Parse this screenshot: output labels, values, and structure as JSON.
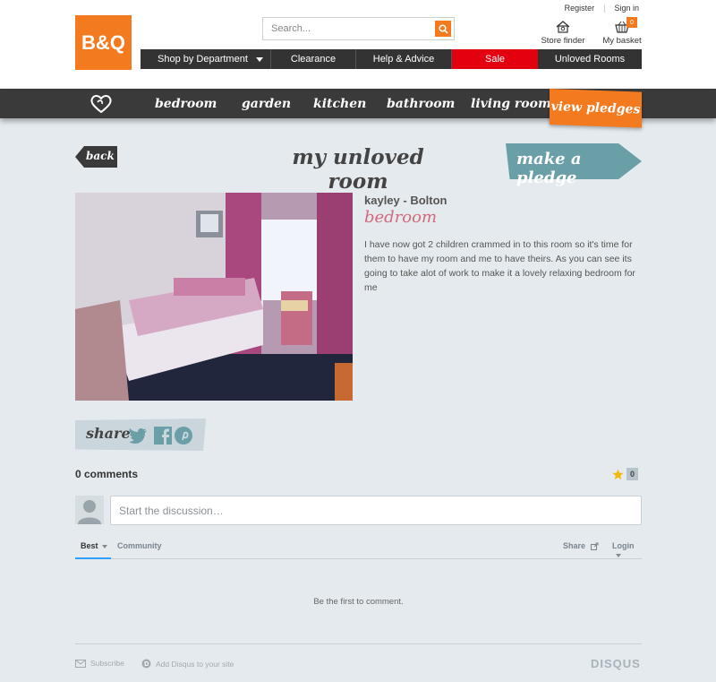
{
  "header": {
    "logo": "B&Q",
    "search": {
      "placeholder": "Search..."
    },
    "register": "Register",
    "signin": "Sign in",
    "store_finder": "Store finder",
    "basket": {
      "label": "My basket",
      "count": "0"
    }
  },
  "main_nav": {
    "items": [
      {
        "label": "Shop by Department"
      },
      {
        "label": "Clearance"
      },
      {
        "label": "Help & Advice"
      },
      {
        "label": "Sale"
      },
      {
        "label": "Unloved Rooms"
      }
    ]
  },
  "categories": {
    "items": [
      {
        "label": "bedroom"
      },
      {
        "label": "garden"
      },
      {
        "label": "kitchen"
      },
      {
        "label": "bathroom"
      },
      {
        "label": "living room"
      }
    ],
    "active": "view pledges"
  },
  "page": {
    "back": "back",
    "title": "my unloved room",
    "make_pledge": "make a pledge"
  },
  "room": {
    "author": "kayley - Bolton",
    "type": "bedroom",
    "description": "I have now got 2 children crammed in to this room so it's time for them to have my room and me to have theirs. As you can see its going to take alot of work to make it a lovely relaxing bedroom for me"
  },
  "share": {
    "label": "share"
  },
  "comments": {
    "count_label": "0 comments",
    "favorite_count": "0",
    "input_placeholder": "Start the discussion…",
    "tabs": {
      "best": "Best",
      "community": "Community",
      "share": "Share",
      "login": "Login"
    },
    "empty_message": "Be the first to comment.",
    "subscribe": "Subscribe",
    "add_disqus": "Add Disqus to your site",
    "brand": "DISQUS"
  },
  "colors": {
    "brand_orange": "#f37a1f",
    "sale_red": "#e3000f",
    "nav_dark": "#333333",
    "pledge_teal": "#6b9fa8",
    "room_type_pink": "#d06a7c",
    "page_bg": "#e4eaee"
  }
}
